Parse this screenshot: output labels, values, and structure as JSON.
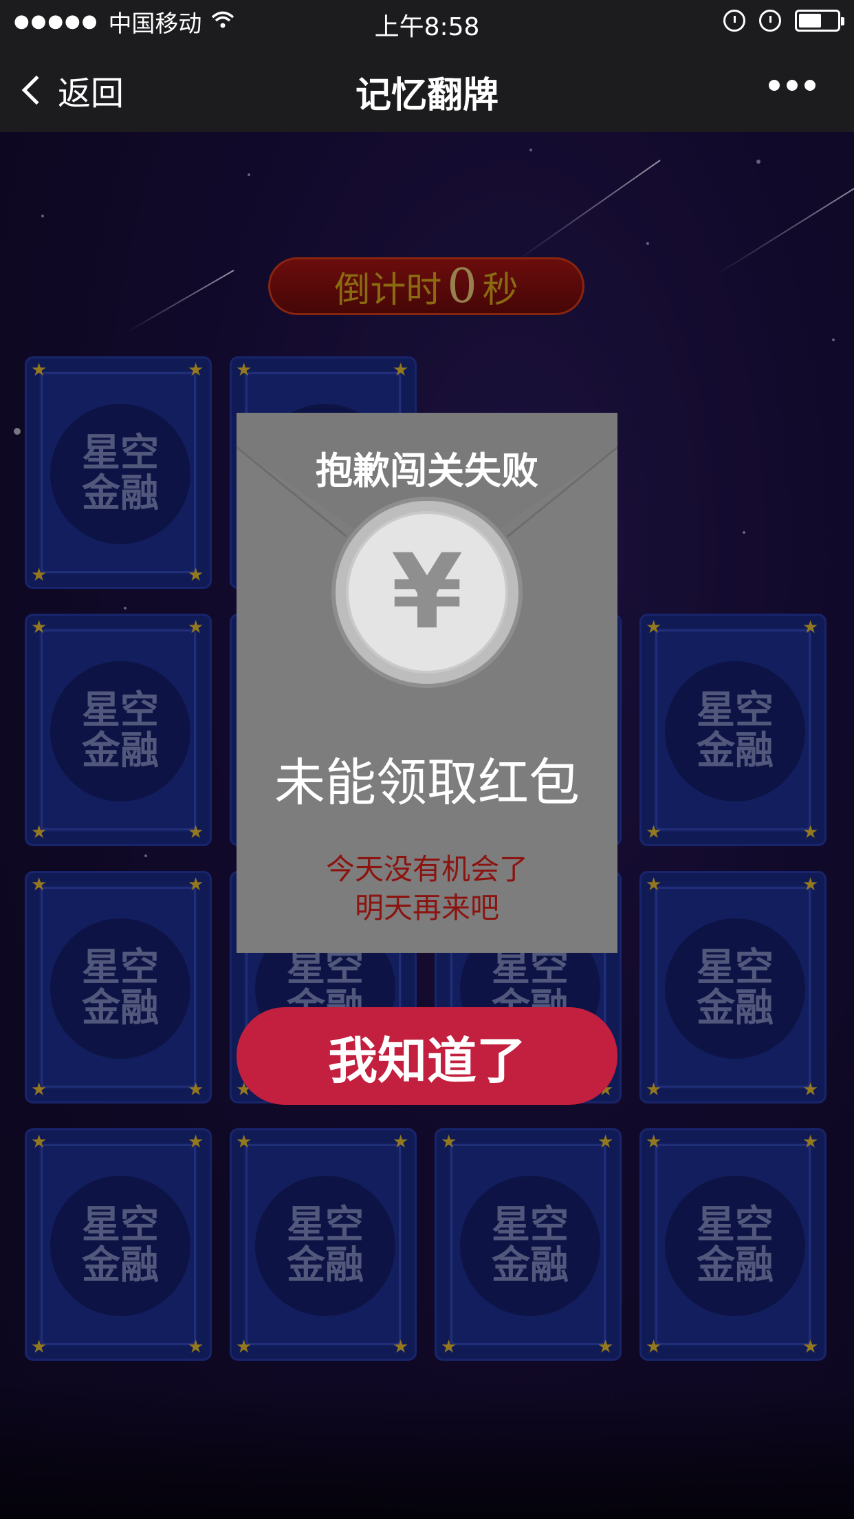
{
  "status": {
    "carrier": "中国移动",
    "signal": "●●●●●",
    "time": "上午8:58"
  },
  "nav": {
    "back_label": "返回",
    "title": "记忆翻牌"
  },
  "timer": {
    "prefix": "倒计时",
    "value": "0",
    "suffix": "秒"
  },
  "card": {
    "line1": "星空",
    "line2": "金融",
    "star": "★"
  },
  "modal": {
    "title": "抱歉闯关失败",
    "coin_symbol": "¥",
    "headline": "未能领取红包",
    "message_line1": "今天没有机会了",
    "message_line2": "明天再来吧",
    "button_label": "我知道了"
  },
  "colors": {
    "card_bg": "#1e2f93",
    "star": "#e2b830",
    "timer_bg": "#a51414",
    "button": "#c31f3e",
    "modal_bg": "#7d7d7d"
  }
}
